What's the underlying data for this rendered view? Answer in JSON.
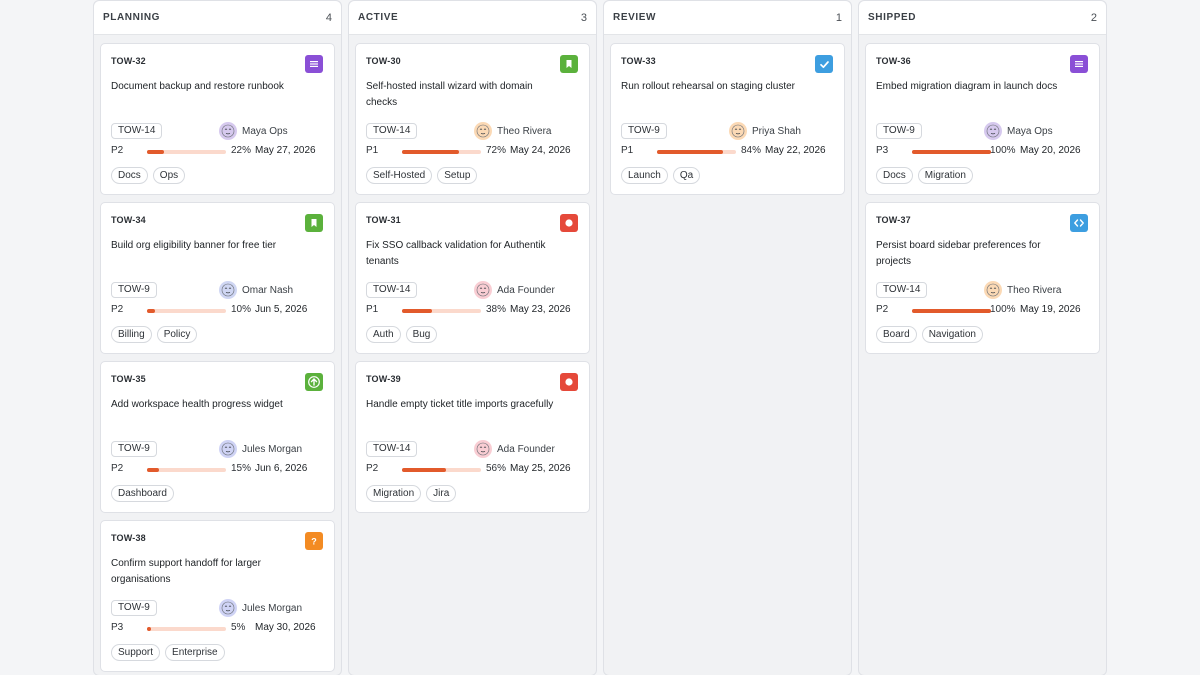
{
  "board": {
    "columns": [
      {
        "title": "PLANNING",
        "count": "4",
        "cards": [
          {
            "key": "TOW-32",
            "title": "Document backup and restore runbook",
            "type_icon": "doc-icon",
            "type_color": "#8a4fd6",
            "epic": "TOW-14",
            "assignee": "Maya Ops",
            "avatar_color": "#d6c9ee",
            "priority": "P2",
            "progress": 22,
            "progress_label": "22%",
            "due": "May 27, 2026",
            "labels": [
              "Docs",
              "Ops"
            ]
          },
          {
            "key": "TOW-34",
            "title": "Build org eligibility banner for free tier",
            "type_icon": "bookmark-icon",
            "type_color": "#5bb13c",
            "epic": "TOW-9",
            "assignee": "Omar Nash",
            "avatar_color": "#cfd6f3",
            "priority": "P2",
            "progress": 10,
            "progress_label": "10%",
            "due": "Jun 5, 2026",
            "labels": [
              "Billing",
              "Policy"
            ]
          },
          {
            "key": "TOW-35",
            "title": "Add workspace health progress widget",
            "type_icon": "arrow-up-icon",
            "type_color": "#5bb13c",
            "epic": "TOW-9",
            "assignee": "Jules Morgan",
            "avatar_color": "#cfd3f5",
            "priority": "P2",
            "progress": 15,
            "progress_label": "15%",
            "due": "Jun 6, 2026",
            "labels": [
              "Dashboard"
            ]
          },
          {
            "key": "TOW-38",
            "title": "Confirm support handoff for larger organisations",
            "type_icon": "question-icon",
            "type_color": "#f38b23",
            "epic": "TOW-9",
            "assignee": "Jules Morgan",
            "avatar_color": "#cfd3f5",
            "priority": "P3",
            "progress": 5,
            "progress_label": "5%",
            "due": "May 30, 2026",
            "labels": [
              "Support",
              "Enterprise"
            ]
          }
        ]
      },
      {
        "title": "ACTIVE",
        "count": "3",
        "cards": [
          {
            "key": "TOW-30",
            "title": "Self-hosted install wizard with domain checks",
            "type_icon": "bookmark-icon",
            "type_color": "#5bb13c",
            "epic": "TOW-14",
            "assignee": "Theo Rivera",
            "avatar_color": "#fbd9b5",
            "priority": "P1",
            "progress": 72,
            "progress_label": "72%",
            "due": "May 24, 2026",
            "labels": [
              "Self-Hosted",
              "Setup"
            ]
          },
          {
            "key": "TOW-31",
            "title": "Fix SSO callback validation for Authentik tenants",
            "type_icon": "bug-icon",
            "type_color": "#e5493a",
            "epic": "TOW-14",
            "assignee": "Ada Founder",
            "avatar_color": "#f9cdd3",
            "priority": "P1",
            "progress": 38,
            "progress_label": "38%",
            "due": "May 23, 2026",
            "labels": [
              "Auth",
              "Bug"
            ]
          },
          {
            "key": "TOW-39",
            "title": "Handle empty ticket title imports gracefully",
            "type_icon": "bug-icon",
            "type_color": "#e5493a",
            "epic": "TOW-14",
            "assignee": "Ada Founder",
            "avatar_color": "#f9cdd3",
            "priority": "P2",
            "progress": 56,
            "progress_label": "56%",
            "due": "May 25, 2026",
            "labels": [
              "Migration",
              "Jira"
            ]
          }
        ]
      },
      {
        "title": "REVIEW",
        "count": "1",
        "cards": [
          {
            "key": "TOW-33",
            "title": "Run rollout rehearsal on staging cluster",
            "type_icon": "checkbox-icon",
            "type_color": "#3d9ee0",
            "epic": "TOW-9",
            "assignee": "Priya Shah",
            "avatar_color": "#fbd9b5",
            "priority": "P1",
            "progress": 84,
            "progress_label": "84%",
            "due": "May 22, 2026",
            "labels": [
              "Launch",
              "Qa"
            ]
          }
        ]
      },
      {
        "title": "SHIPPED",
        "count": "2",
        "cards": [
          {
            "key": "TOW-36",
            "title": "Embed migration diagram in launch docs",
            "type_icon": "doc-icon",
            "type_color": "#8a4fd6",
            "epic": "TOW-9",
            "assignee": "Maya Ops",
            "avatar_color": "#d6c9ee",
            "priority": "P3",
            "progress": 100,
            "progress_label": "100%",
            "due": "May 20, 2026",
            "labels": [
              "Docs",
              "Migration"
            ]
          },
          {
            "key": "TOW-37",
            "title": "Persist board sidebar preferences for projects",
            "type_icon": "code-icon",
            "type_color": "#3d9ee0",
            "epic": "TOW-14",
            "assignee": "Theo Rivera",
            "avatar_color": "#fbd9b5",
            "priority": "P2",
            "progress": 100,
            "progress_label": "100%",
            "due": "May 19, 2026",
            "labels": [
              "Board",
              "Navigation"
            ]
          }
        ]
      }
    ]
  }
}
